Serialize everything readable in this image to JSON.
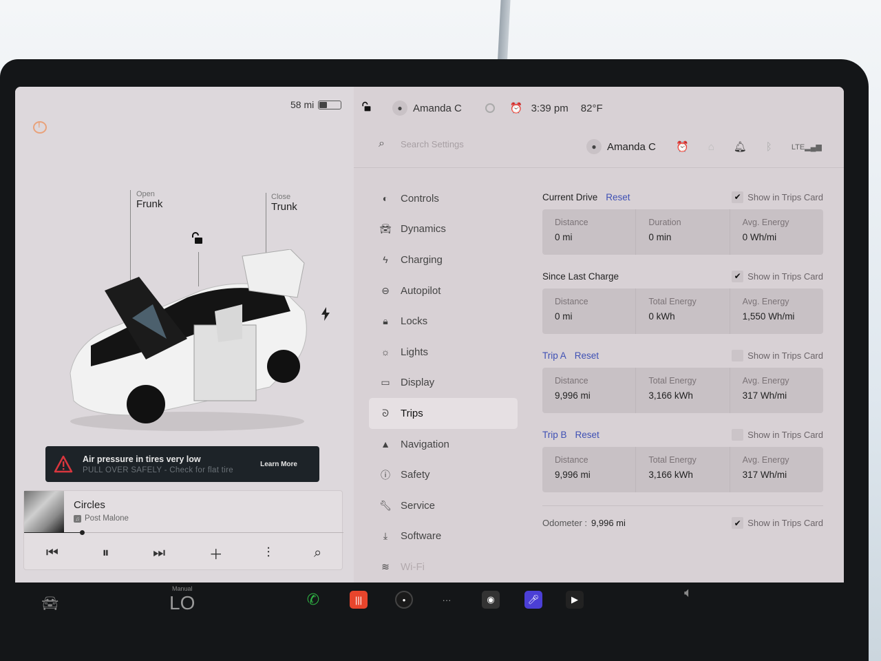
{
  "status_bar": {
    "range": "58 mi",
    "battery_level": 0.35,
    "driver_name": "Amanda C",
    "time": "3:39 pm",
    "temperature": "82°F"
  },
  "car_panel": {
    "frunk": {
      "action": "Open",
      "label": "Frunk"
    },
    "trunk": {
      "action": "Close",
      "label": "Trunk"
    },
    "alert": {
      "title": "Air pressure in tires very low",
      "subtitle": "PULL OVER SAFELY - Check for flat tire",
      "action": "Learn More"
    }
  },
  "media": {
    "title": "Circles",
    "artist": "Post Malone",
    "progress": 0.18
  },
  "settings": {
    "search_placeholder": "Search Settings",
    "user_name": "Amanda C",
    "nav": [
      {
        "label": "Controls",
        "icon": "toggle-icon"
      },
      {
        "label": "Dynamics",
        "icon": "car-icon"
      },
      {
        "label": "Charging",
        "icon": "bolt-icon"
      },
      {
        "label": "Autopilot",
        "icon": "steering-wheel-icon"
      },
      {
        "label": "Locks",
        "icon": "lock-icon"
      },
      {
        "label": "Lights",
        "icon": "sun-icon"
      },
      {
        "label": "Display",
        "icon": "display-icon"
      },
      {
        "label": "Trips",
        "icon": "trips-icon"
      },
      {
        "label": "Navigation",
        "icon": "navigation-arrow-icon"
      },
      {
        "label": "Safety",
        "icon": "alert-circle-icon"
      },
      {
        "label": "Service",
        "icon": "wrench-icon"
      },
      {
        "label": "Software",
        "icon": "download-icon"
      },
      {
        "label": "Wi-Fi",
        "icon": "wifi-icon"
      }
    ],
    "active_nav": "Trips",
    "show_in_trips_label": "Show in Trips Card",
    "reset_label": "Reset",
    "sections": {
      "current_drive": {
        "title": "Current Drive",
        "show_checked": true,
        "stats": [
          {
            "label": "Distance",
            "value": "0 mi"
          },
          {
            "label": "Duration",
            "value": "0 min"
          },
          {
            "label": "Avg. Energy",
            "value": "0 Wh/mi"
          }
        ]
      },
      "since_last_charge": {
        "title": "Since Last Charge",
        "show_checked": true,
        "stats": [
          {
            "label": "Distance",
            "value": "0 mi"
          },
          {
            "label": "Total Energy",
            "value": "0 kWh"
          },
          {
            "label": "Avg. Energy",
            "value": "1,550 Wh/mi"
          }
        ]
      },
      "trip_a": {
        "title": "Trip A",
        "show_checked": false,
        "stats": [
          {
            "label": "Distance",
            "value": "9,996 mi"
          },
          {
            "label": "Total Energy",
            "value": "3,166 kWh"
          },
          {
            "label": "Avg. Energy",
            "value": "317 Wh/mi"
          }
        ]
      },
      "trip_b": {
        "title": "Trip B",
        "show_checked": false,
        "stats": [
          {
            "label": "Distance",
            "value": "9,996 mi"
          },
          {
            "label": "Total Energy",
            "value": "3,166 kWh"
          },
          {
            "label": "Avg. Energy",
            "value": "317 Wh/mi"
          }
        ]
      }
    },
    "odometer": {
      "label": "Odometer :",
      "value": "9,996 mi",
      "show_checked": true
    }
  },
  "dock": {
    "climate_mode": "Manual",
    "climate_temp": "LO",
    "apps": [
      "phone",
      "audio",
      "camera",
      "more",
      "dashcam",
      "karaoke",
      "theater"
    ]
  },
  "colors": {
    "accent_link": "#3e50b4",
    "alarm_orange": "#e8763a",
    "alert_red": "#d9363e",
    "phone_green": "#2fb344",
    "audio_red": "#e8452c",
    "karaoke_purple": "#4b3fd6"
  }
}
